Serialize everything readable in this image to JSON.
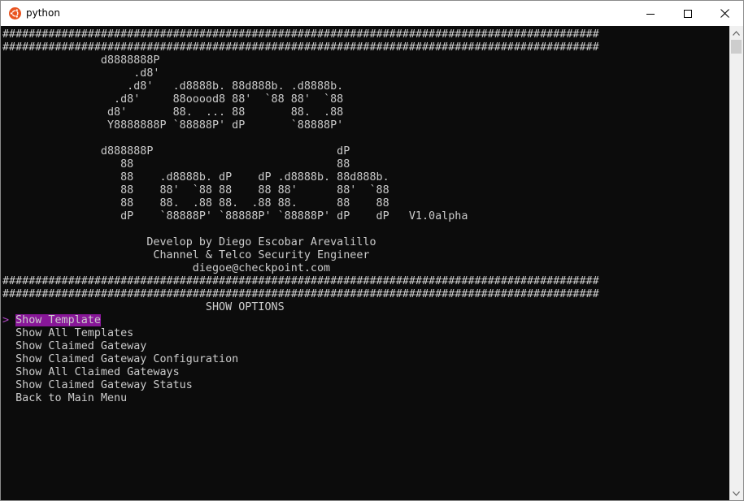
{
  "window": {
    "title": "python",
    "icon": "ubuntu-logo-icon",
    "controls": [
      "minimize-icon",
      "maximize-icon",
      "close-icon"
    ]
  },
  "console": {
    "banner_lines": [
      "###########################################################################################",
      "###########################################################################################",
      "               d8888888P",
      "                    .d8'",
      "                   .d8'   .d8888b. 88d888b. .d8888b.",
      "                 .d8'     88ooood8 88'  `88 88'  `88",
      "                d8'       88.  ... 88       88.  .88",
      "                Y8888888P `88888P' dP       `88888P'",
      "",
      "               d888888P                            dP",
      "                  88                               88",
      "                  88    .d8888b. dP    dP .d8888b. 88d888b.",
      "                  88    88'  `88 88    88 88'      88'  `88",
      "                  88    88.  .88 88.  .88 88.      88    88",
      "                  dP    `88888P' `88888P' `88888P' dP    dP   V1.0alpha",
      "",
      "                      Develop by Diego Escobar Arevalillo",
      "                       Channel & Telco Security Engineer",
      "                             diegoe@checkpoint.com",
      "###########################################################################################",
      "###########################################################################################",
      "                               SHOW OPTIONS"
    ],
    "cursor": ">",
    "selected_index": 0,
    "menu": [
      "Show Template",
      "Show All Templates",
      "Show Claimed Gateway",
      "Show Claimed Gateway Configuration",
      "Show All Claimed Gateways",
      "Show Claimed Gateway Status",
      "Back to Main Menu"
    ]
  },
  "colors": {
    "console_bg": "#0c0c0c",
    "console_fg": "#cccccc",
    "selection_bg": "#881798",
    "cursor": "#b148c6",
    "icon_orange": "#e95420"
  }
}
